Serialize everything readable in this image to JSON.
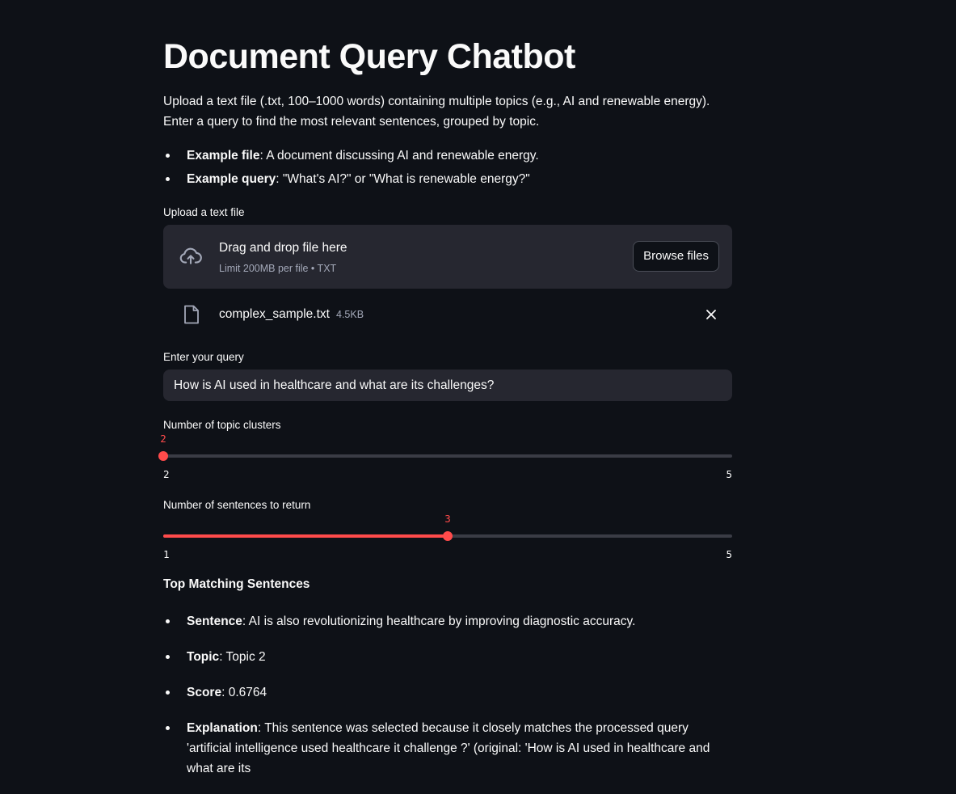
{
  "page": {
    "title": "Document Query Chatbot",
    "intro": "Upload a text file (.txt, 100–1000 words) containing multiple topics (e.g., AI and renewable energy). Enter a query to find the most relevant sentences, grouped by topic.",
    "examples": [
      {
        "label": "Example file",
        "text": ": A document discussing AI and renewable energy."
      },
      {
        "label": "Example query",
        "text": ": \"What's AI?\" or \"What is renewable energy?\""
      }
    ]
  },
  "uploader": {
    "label": "Upload a text file",
    "drop_text": "Drag and drop file here",
    "limit_text": "Limit 200MB per file • TXT",
    "browse_label": "Browse files",
    "file": {
      "name": "complex_sample.txt",
      "size": "4.5KB"
    },
    "icons": {
      "drop": "cloud-upload-icon",
      "file": "file-icon",
      "remove": "close-icon"
    }
  },
  "query": {
    "label": "Enter your query",
    "value": "How is AI used in healthcare and what are its challenges?"
  },
  "sliders": [
    {
      "label": "Number of topic clusters",
      "value": "2",
      "min": "2",
      "max": "5",
      "fraction": 0
    },
    {
      "label": "Number of sentences to return",
      "value": "3",
      "min": "1",
      "max": "5",
      "fraction": 0.5
    }
  ],
  "results": {
    "heading": "Top Matching Sentences",
    "items": [
      {
        "label": "Sentence",
        "text": ": AI is also revolutionizing healthcare by improving diagnostic accuracy."
      },
      {
        "label": "Topic",
        "text": ": Topic 2"
      },
      {
        "label": "Score",
        "text": ": 0.6764"
      },
      {
        "label": "Explanation",
        "text": ": This sentence was selected because it closely matches the processed query 'artificial intelligence used healthcare it challenge ?' (original: 'How is AI used in healthcare and what are its"
      }
    ]
  },
  "colors": {
    "background": "#0e1117",
    "surface": "#262730",
    "accent": "#ff4b4b",
    "text": "#fafafa",
    "muted": "#a3a8b8"
  }
}
